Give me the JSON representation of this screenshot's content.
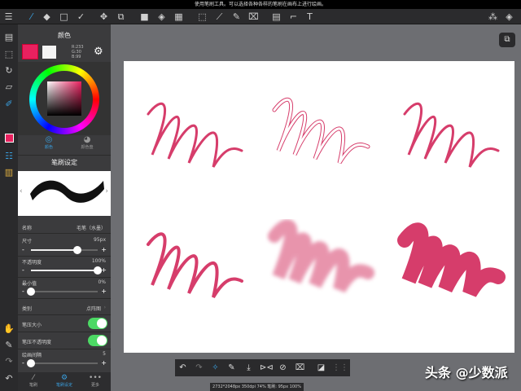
{
  "status_message": "使用笔刷工具。可以选择各种各样的笔刷在画布上进行绘画。",
  "toolbar": {
    "icons": [
      "menu-icon",
      "brush-icon",
      "eraser-icon",
      "shape-icon",
      "check-icon",
      "move-icon",
      "transform-icon",
      "fill-color-icon",
      "bucket-icon",
      "gradient-icon",
      "select-rect-icon",
      "magic-wand-icon",
      "select-pen-icon",
      "select-eraser-icon",
      "layer-panel-icon",
      "select-move-icon",
      "text-icon",
      "materials-icon",
      "layers-icon"
    ]
  },
  "color_panel": {
    "title": "颜色",
    "primary_color": "#e9215f",
    "rgb": {
      "r": "R:233",
      "g": "G:30",
      "b": "B:99"
    },
    "tabs": [
      {
        "label": "颜色"
      },
      {
        "label": "颜色盘"
      }
    ]
  },
  "brush_settings": {
    "title": "笔刷设定",
    "name_label": "名称",
    "name_value": "毛笔（水墨）",
    "size_label": "尺寸",
    "size_value": "95px",
    "size_fraction": 0.7,
    "opacity_label": "不透明度",
    "opacity_value": "100%",
    "opacity_fraction": 1.0,
    "min_label": "最小值",
    "min_value": "0%",
    "min_fraction": 0.0,
    "category_label": "类别",
    "category_value": "点阵图",
    "pressure_size_label": "笔压大小",
    "pressure_size_on": true,
    "pressure_opacity_label": "笔压不透明度",
    "pressure_opacity_on": true,
    "spacing_label": "绘画间隔",
    "spacing_value": "5",
    "spacing_fraction": 0.0
  },
  "panel_tabs": [
    {
      "label": "笔刷"
    },
    {
      "label": "笔刷设定"
    },
    {
      "label": "更多"
    }
  ],
  "stroke_color": "#d63d6b",
  "info": "2732*2048px 350dpi 74% 笔刷: 95px 100%",
  "watermark": "头条 @少数派"
}
